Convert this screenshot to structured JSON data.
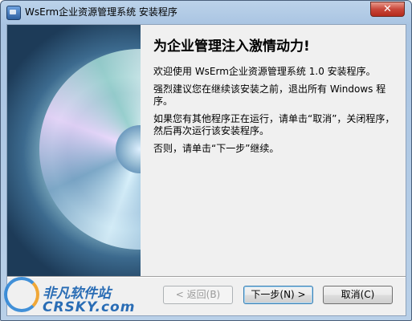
{
  "window": {
    "title": "WsErm企业资源管理系统 安装程序",
    "close_label": "✕"
  },
  "content": {
    "heading": "为企业管理注入激情动力!",
    "paragraphs": [
      "欢迎使用 WsErm企业资源管理系统 1.0 安装程序。",
      "强烈建议您在继续该安装之前，退出所有 Windows 程序。",
      "如果您有其他程序正在运行，请单击“取消”，关闭程序，然后再次运行该安装程序。",
      "否则，请单击“下一步”继续。"
    ]
  },
  "buttons": {
    "back": "< 返回(B)",
    "next": "下一步(N) >",
    "cancel": "取消(C)"
  },
  "watermark": {
    "brand_cn": "非凡软件站",
    "brand_en": "CRSKY.com"
  },
  "colors": {
    "accent": "#2a6db5",
    "close": "#c8473a"
  }
}
